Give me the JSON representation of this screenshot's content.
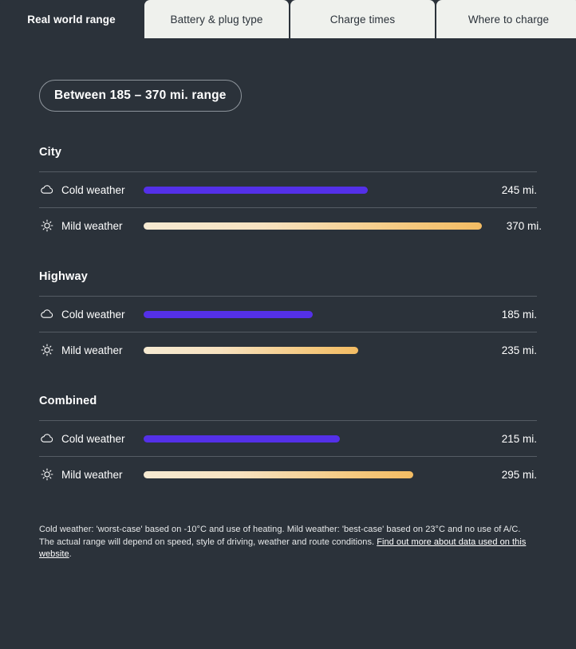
{
  "tabs": [
    {
      "label": "Real world range",
      "active": true
    },
    {
      "label": "Battery & plug type",
      "active": false
    },
    {
      "label": "Charge times",
      "active": false
    },
    {
      "label": "Where to charge",
      "active": false
    }
  ],
  "range_pill": {
    "label": "Between 185 – 370 mi. range"
  },
  "colors": {
    "background": "#2b323a",
    "tab_inactive_bg": "#eff1ed",
    "cold_bar": "#5430e8",
    "mild_bar_start": "#f6ead2",
    "mild_bar_end": "#f3bc63",
    "divider": "#555c64",
    "text": "#ffffff"
  },
  "scale": {
    "max_value": 370,
    "unit": "mi."
  },
  "sections": [
    {
      "title": "City",
      "rows": [
        {
          "icon": "cloud-icon",
          "label": "Cold weather",
          "value": 245,
          "value_label": "245 mi.",
          "type": "cold"
        },
        {
          "icon": "sun-icon",
          "label": "Mild weather",
          "value": 370,
          "value_label": "370 mi.",
          "type": "mild"
        }
      ]
    },
    {
      "title": "Highway",
      "rows": [
        {
          "icon": "cloud-icon",
          "label": "Cold weather",
          "value": 185,
          "value_label": "185 mi.",
          "type": "cold"
        },
        {
          "icon": "sun-icon",
          "label": "Mild weather",
          "value": 235,
          "value_label": "235 mi.",
          "type": "mild"
        }
      ]
    },
    {
      "title": "Combined",
      "rows": [
        {
          "icon": "cloud-icon",
          "label": "Cold weather",
          "value": 215,
          "value_label": "215 mi.",
          "type": "cold"
        },
        {
          "icon": "sun-icon",
          "label": "Mild weather",
          "value": 295,
          "value_label": "295 mi.",
          "type": "mild"
        }
      ]
    }
  ],
  "footnote": {
    "text_before": "Cold weather: 'worst-case' based on -10°C and use of heating. Mild weather: 'best-case' based on 23°C and no use of A/C. The actual range will depend on speed, style of driving, weather and route conditions. ",
    "link_text": "Find out more about data used on this website",
    "text_after": "."
  },
  "chart_data": {
    "type": "bar",
    "title": "Real world range",
    "subtitle": "Between 185 – 370 mi. range",
    "unit": "mi.",
    "xlim": [
      0,
      370
    ],
    "grid": false,
    "legend": [
      "Cold weather",
      "Mild weather"
    ],
    "groups": [
      "City",
      "Highway",
      "Combined"
    ],
    "series": [
      {
        "name": "Cold weather",
        "values": [
          245,
          185,
          215
        ],
        "color": "#5430e8"
      },
      {
        "name": "Mild weather",
        "values": [
          370,
          235,
          295
        ],
        "color": "#f3bc63"
      }
    ]
  }
}
